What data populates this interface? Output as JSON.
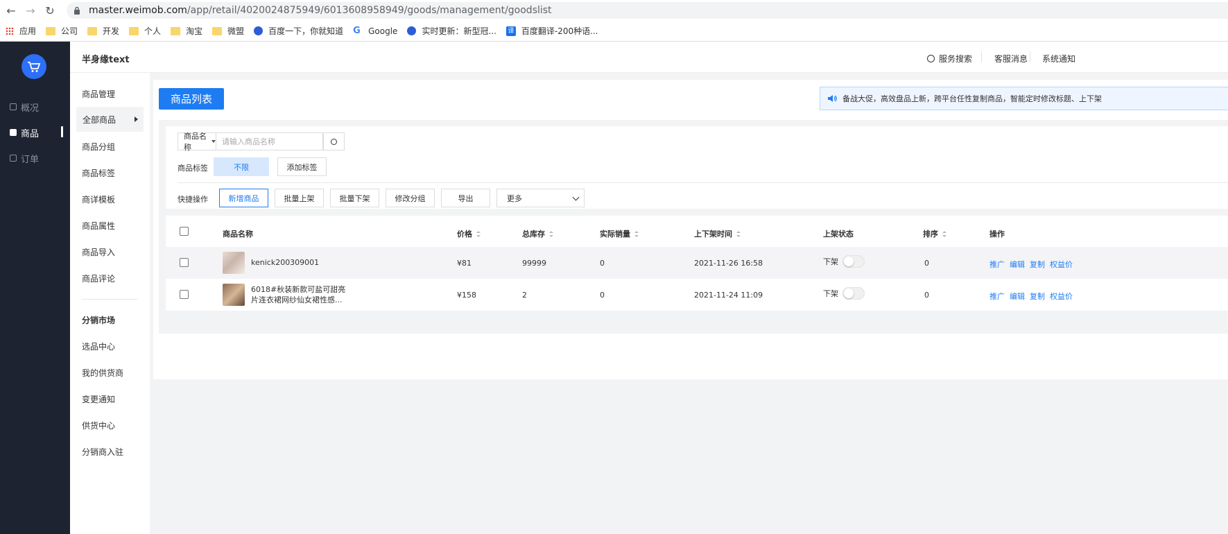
{
  "browser": {
    "url_host": "master.weimob.com",
    "url_path": "/app/retail/4020024875949/6013608958949/goods/management/goodslist",
    "bookmarks": [
      "应用",
      "公司",
      "开发",
      "个人",
      "淘宝",
      "微盟",
      "百度一下，你就知道",
      "Google",
      "实时更新：新型冠...",
      "百度翻译-200种语..."
    ]
  },
  "sidebar": {
    "items": [
      {
        "label": "概况"
      },
      {
        "label": "商品"
      },
      {
        "label": "订单"
      }
    ]
  },
  "header": {
    "shop_name": "半身缘text",
    "links": [
      "服务搜索",
      "客服消息",
      "系统通知"
    ]
  },
  "submenu": {
    "items": [
      "商品管理",
      "全部商品",
      "商品分组",
      "商品标签",
      "商详模板",
      "商品属性",
      "商品导入",
      "商品评论"
    ],
    "group_title": "分销市场",
    "group_items": [
      "选品中心",
      "我的供货商",
      "变更通知",
      "供货中心",
      "分销商入驻"
    ]
  },
  "main": {
    "title": "商品列表",
    "notice": "备战大促，高效盘品上新，跨平台任性复制商品，智能定时修改标题、上下架",
    "filter": {
      "field_select": "商品名称",
      "search_placeholder": "请输入商品名称",
      "tag_label": "商品标签",
      "tag_any": "不限",
      "tag_add": "添加标签",
      "quick_label": "快捷操作",
      "quick_buttons": [
        "新增商品",
        "批量上架",
        "批量下架",
        "修改分组",
        "导出"
      ],
      "more": "更多"
    },
    "table": {
      "headers": [
        "商品名称",
        "价格",
        "总库存",
        "实际销量",
        "上下架时间",
        "上架状态",
        "排序",
        "操作"
      ],
      "rows": [
        {
          "name": "kenick200309001",
          "price": "¥81",
          "stock": "99999",
          "sales": "0",
          "time": "2021-11-26 16:58",
          "status": "下架",
          "sort": "0"
        },
        {
          "name": "6018#秋装新款可盐可甜亮片连衣裙网纱仙女裙性感...",
          "price": "¥158",
          "stock": "2",
          "sales": "0",
          "time": "2021-11-24 11:09",
          "status": "下架",
          "sort": "0"
        }
      ],
      "ops": [
        "推广",
        "编辑",
        "复制",
        "权益价"
      ]
    }
  },
  "colors": {
    "primary": "#1e7cf2",
    "sidebar_bg": "#1e2331",
    "page_bg": "#f2f3f5"
  }
}
